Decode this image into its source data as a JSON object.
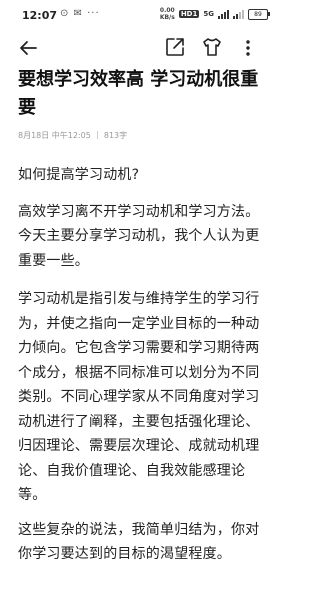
{
  "status_bar": {
    "time": "12:07",
    "notif_icons": "⊙ ✉ ···",
    "net_speed_value": "0.00",
    "net_speed_unit": "KB/s",
    "hd_label": "HD1",
    "network": "5G",
    "battery": "89"
  },
  "article": {
    "title": "要想学习效率高 学习动机很重要",
    "date": "8月18日 中午12:05",
    "word_count": "813字",
    "question": "如何提高学习动机?",
    "intro": " 高效学习离不开学习动机和学习方法。今天主要分享学习动机，我个人认为更重要一些。",
    "body": "学习动机是指引发与维持学生的学习行为，并使之指向一定学业目标的一种动力倾向。它包含学习需要和学习期待两个成分，根据不同标准可以划分为不同类别。不同心理学家从不同角度对学习动机进行了阐释，主要包括强化理论、归因理论、需要层次理论、成就动机理论、自我价值理论、自我效能感理论等。",
    "summary": "这些复杂的说法，我简单归结为，你对你学习要达到的目标的渴望程度。"
  },
  "icons": {
    "back": "back-arrow-icon",
    "share": "share-icon",
    "theme": "shirt-icon",
    "more": "more-icon"
  }
}
